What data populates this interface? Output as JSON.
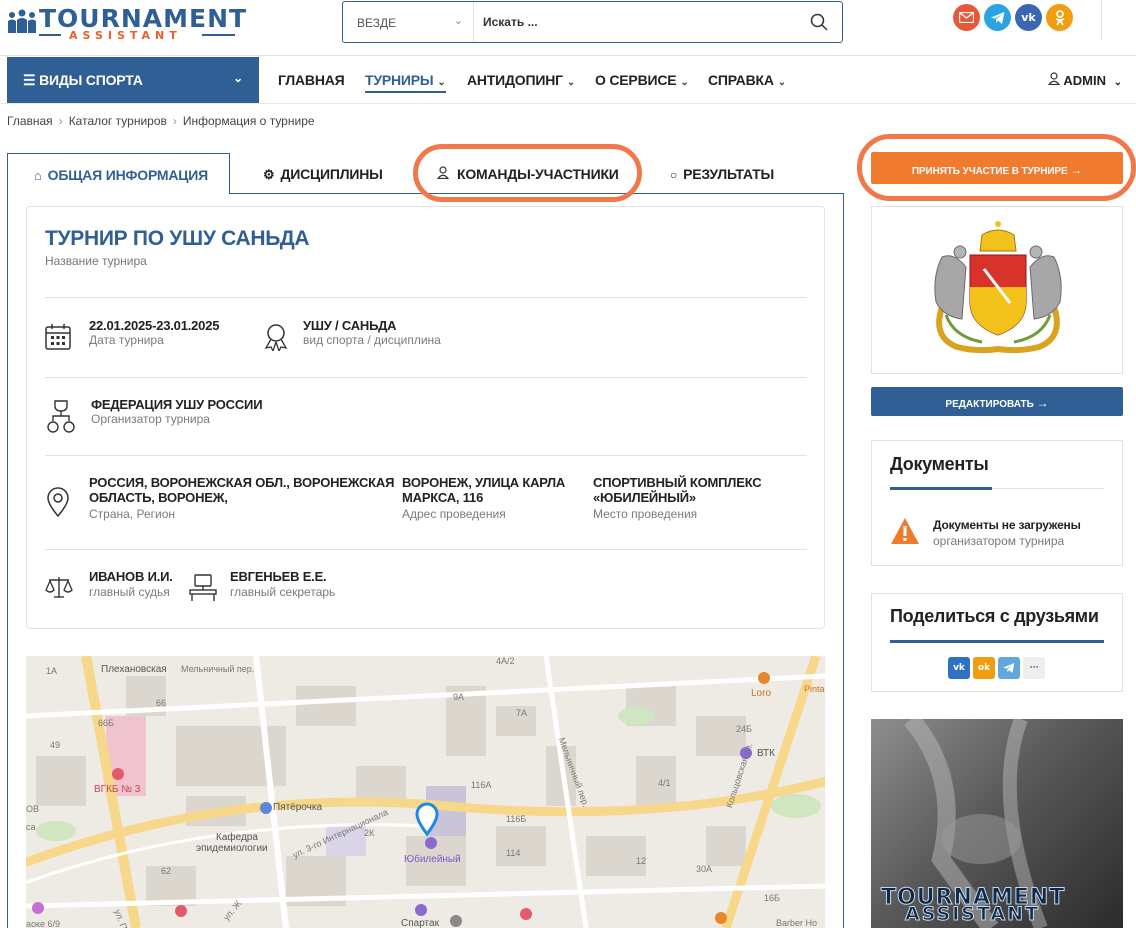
{
  "header": {
    "logo_main": "TOURNAMENT",
    "logo_sub": "ASSISTANT",
    "search_scope": "ВЕЗДЕ",
    "search_placeholder": "Искать ...",
    "socials": [
      "mail-icon",
      "telegram-icon",
      "vk-icon",
      "ok-icon"
    ]
  },
  "nav": {
    "sports": "ВИДЫ СПОРТА",
    "items": [
      "ГЛАВНАЯ",
      "ТУРНИРЫ",
      "АНТИДОПИНГ",
      "О СЕРВИСЕ",
      "СПРАВКА"
    ],
    "user": "ADMIN"
  },
  "breadcrumbs": [
    "Главная",
    "Каталог турниров",
    "Информация о турнире"
  ],
  "tabs": [
    "ОБЩАЯ ИНФОРМАЦИЯ",
    "ДИСЦИПЛИНЫ",
    "КОМАНДЫ-УЧАСТНИКИ",
    "РЕЗУЛЬТАТЫ"
  ],
  "tournament": {
    "name": "ТУРНИР ПО УШУ САНЬДА",
    "name_caption": "Название турнира",
    "dates": "22.01.2025-23.01.2025",
    "dates_caption": "Дата турнира",
    "sport": "УШУ / САНЬДА",
    "sport_caption": "вид спорта / дисциплина",
    "organizer": "ФЕДЕРАЦИЯ УШУ РОССИИ",
    "organizer_caption": "Организатор турнира",
    "region_line1": "РОССИЯ, ВОРОНЕЖСКАЯ ОБЛ., ВОРОНЕЖСКАЯ",
    "region_line2": "ОБЛАСТЬ, ВОРОНЕЖ,",
    "region_caption": "Страна, Регион",
    "address_line1": "ВОРОНЕЖ, УЛИЦА КАРЛА",
    "address_line2": "МАРКСА, 116",
    "address_caption": "Адрес проведения",
    "venue_line1": "СПОРТИВНЫЙ КОМПЛЕКС",
    "venue_line2": "«ЮБИЛЕЙНЫЙ»",
    "venue_caption": "Место проведения",
    "judge": "ИВАНОВ И.И.",
    "judge_caption": "главный судья",
    "secretary": "ЕВГЕНЬЕВ Е.Е.",
    "secretary_caption": "главный секретарь"
  },
  "map": {
    "labels": [
      "Плехановская",
      "Мельничный пер.",
      "Пятёрочка",
      "Кафедра",
      "эпидемиологии",
      "Юбилейный",
      "ВГКБ № 3",
      "Спартак",
      "ВТК",
      "Loro",
      "Кольцовская ул.",
      "ул. 3-го Интернационала",
      "Мельничный пер.",
      "4А/2",
      "9А",
      "7А",
      "116А",
      "116Б",
      "114",
      "2К",
      "66Б",
      "66",
      "4/1",
      "24Б",
      "30А",
      "12",
      "16Б",
      "1А",
      "49",
      "62",
      "Barber Ho",
      "Pinta",
      "аоке 6/9",
      "ул. Ж",
      "ул. Пл",
      "са",
      "ОВ"
    ]
  },
  "sidebar": {
    "join": "ПРИНЯТЬ УЧАСТИЕ В ТУРНИРЕ",
    "edit": "РЕДАКТИРОВАТЬ",
    "docs_title": "Документы",
    "docs_status": "Документы не загружены",
    "docs_status_sub": "организатором турнира",
    "share_title": "Поделиться с друзьями",
    "share_icons": [
      "vk-icon",
      "ok-icon",
      "telegram-icon",
      "more-icon"
    ],
    "banner_line1": "TOURNAMENT",
    "banner_line2": "ASSISTANT"
  },
  "colors": {
    "brand": "#2f5f94",
    "accent": "#f07a2e",
    "highlight": "#f2784a"
  }
}
